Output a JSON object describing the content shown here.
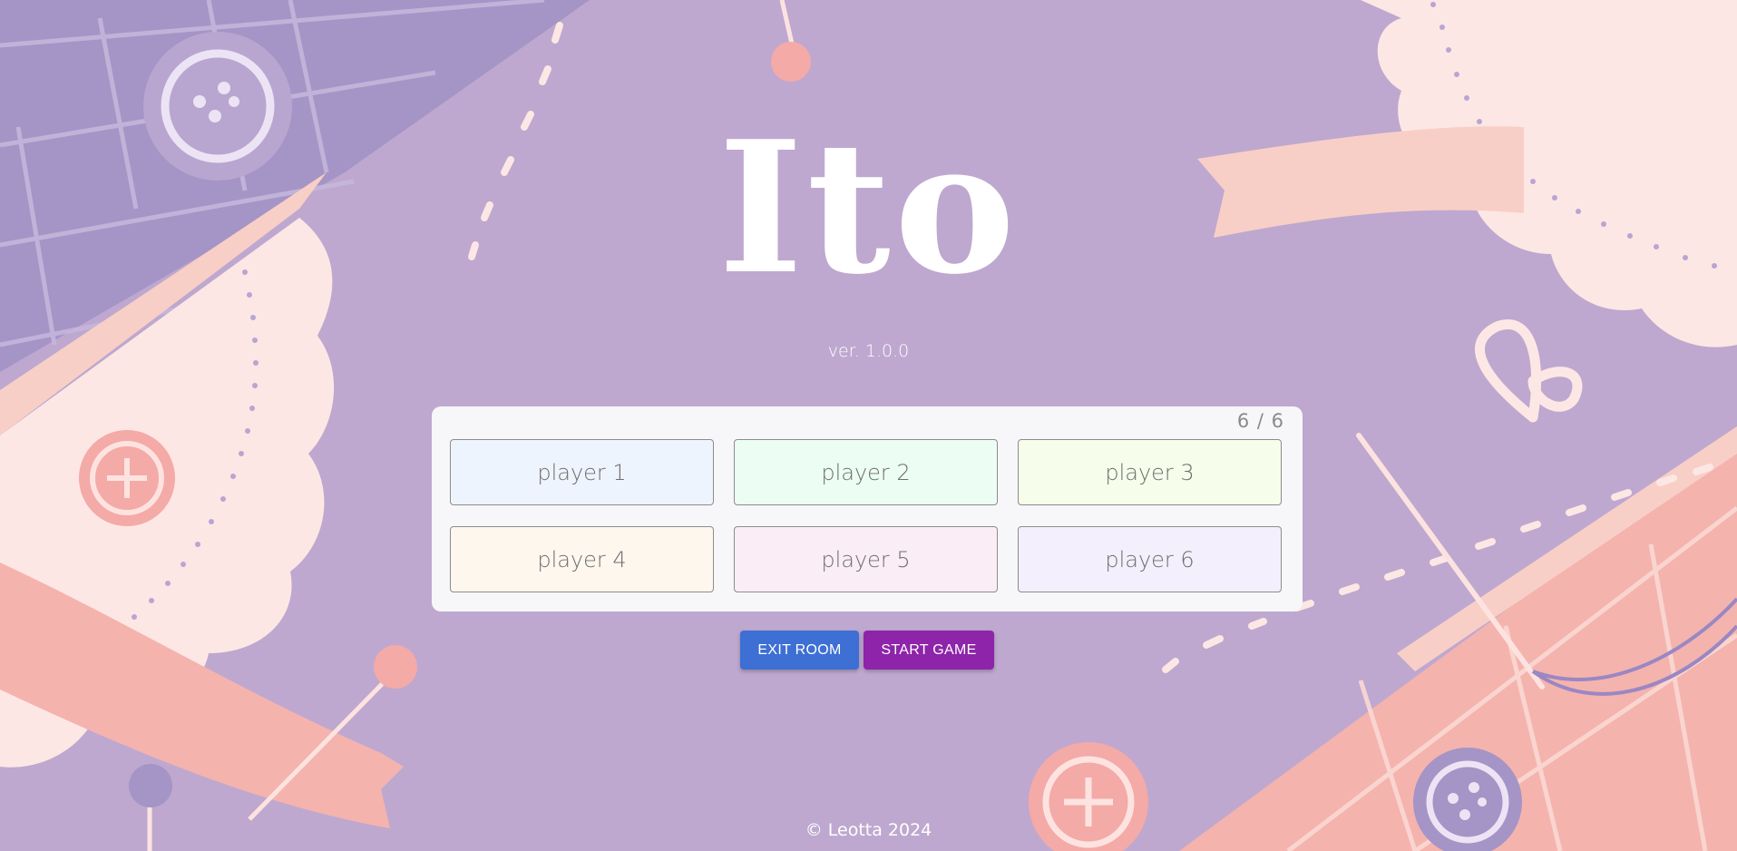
{
  "app": {
    "title": "Ito",
    "version": "ver. 1.0.0",
    "footer": "© Leotta 2024"
  },
  "lobby": {
    "player_count": "6 / 6",
    "players": [
      {
        "name": "player 1",
        "color": "#eef4fd"
      },
      {
        "name": "player 2",
        "color": "#ecfdf4"
      },
      {
        "name": "player 3",
        "color": "#f6fdeb"
      },
      {
        "name": "player 4",
        "color": "#fef7ee"
      },
      {
        "name": "player 5",
        "color": "#fbedf5"
      },
      {
        "name": "player 6",
        "color": "#f4effc"
      }
    ]
  },
  "actions": {
    "exit_label": "EXIT ROOM",
    "exit_color": "#3d6fd4",
    "start_label": "START GAME",
    "start_color": "#8e24aa"
  },
  "theme": {
    "background": "#bea8cf",
    "accent_pink": "#f4b3ad",
    "light_pink": "#fce6e6",
    "deep_lavender": "#a394c6"
  }
}
